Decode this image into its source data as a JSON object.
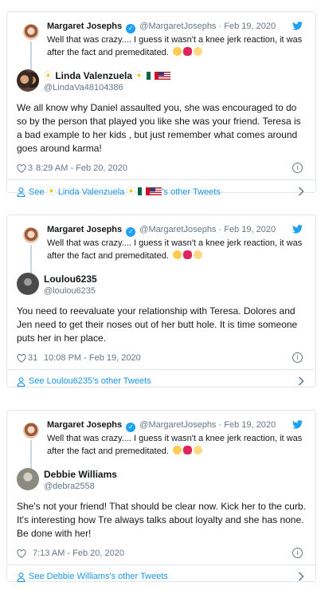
{
  "quoted": {
    "name": "Margaret Josephs",
    "handle": "@MargaretJosephs",
    "date": "Feb 19, 2020",
    "text": "Well that was crazy.... I guess it wasn't a knee jerk reaction, it was after the fact and premeditated."
  },
  "replies": [
    {
      "name": "Linda Valenzuela",
      "handle": "@LindaVa48104386",
      "text": "We all know why Daniel assaulted you, she was encouraged to do so by the person that played you like she was your friend. Teresa is a bad example to her kids , but just remember what comes around goes around karma!",
      "likes": "3",
      "time": "8:29 AM - Feb 20, 2020",
      "footer": "See",
      "footer_name": "Linda Valenzuela",
      "footer_suffix": "'s other Tweets"
    },
    {
      "name": "Loulou6235",
      "handle": "@loulou6235",
      "text": "You need to reevaluate your relationship with Teresa. Dolores and Jen need to get their noses out of her butt hole. It is time someone puts her in her place.",
      "likes": "31",
      "time": "10:08 PM - Feb 19, 2020",
      "footer": "See Loulou6235's other Tweets"
    },
    {
      "name": "Debbie Williams",
      "handle": "@debra2558",
      "text": "She's not your friend! That should be clear now. Kick her to the curb. It's interesting how Tre always talks about loyalty and she has none. Be done with her!",
      "likes": "",
      "time": "7:13 AM - Feb 20, 2020",
      "footer": "See Debbie Williams's other Tweets"
    }
  ],
  "icons": {
    "verified": "verified-badge-icon",
    "bird": "twitter-bird-icon",
    "heart": "heart-icon",
    "info": "info-icon",
    "person": "person-icon",
    "chevron": "chevron-right-icon",
    "info_glyph": "i",
    "check_glyph": "✓"
  },
  "colors": {
    "twitter_blue": "#1da1f2",
    "link_blue": "#1b95e0",
    "text": "#14171a",
    "muted": "#657786",
    "border": "#e1e8ed"
  }
}
